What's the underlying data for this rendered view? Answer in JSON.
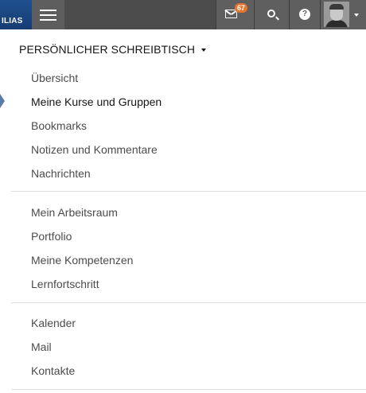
{
  "topbar": {
    "logo_text": "ILIAS",
    "mail_badge": "67",
    "help_glyph": "?",
    "icons": [
      "menu-icon",
      "mail-icon",
      "search-icon",
      "help-icon",
      "avatar",
      "chevron-down-icon"
    ]
  },
  "desktop": {
    "heading": "PERSÖNLICHER SCHREIBTISCH",
    "groups": [
      {
        "items": [
          "Übersicht",
          "Meine Kurse und Gruppen",
          "Bookmarks",
          "Notizen und Kommentare",
          "Nachrichten"
        ]
      },
      {
        "items": [
          "Mein Arbeitsraum",
          "Portfolio",
          "Meine Kompetenzen",
          "Lernfortschritt"
        ]
      },
      {
        "items": [
          "Kalender",
          "Mail",
          "Kontakte"
        ]
      }
    ],
    "active_item": "Meine Kurse und Gruppen"
  },
  "colors": {
    "topbar_bg": "#4c4c4c",
    "logo_bg": "#1f4f8f",
    "badge_bg": "#e5752e",
    "active_pointer": "#5c7ca8"
  }
}
